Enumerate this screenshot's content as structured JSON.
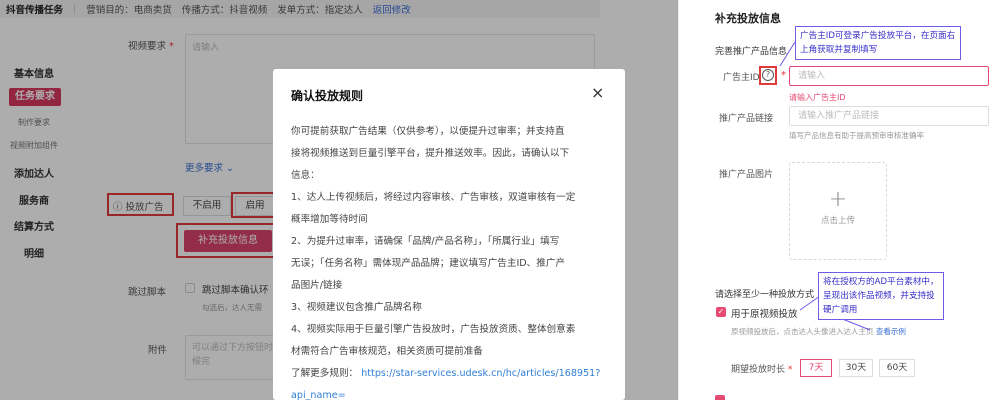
{
  "topbar": {
    "app": "抖音传播任务",
    "goal": "营销目的：电商卖货",
    "method": "传播方式：抖音视频",
    "publish": "发单方式：指定达人",
    "back": "返回修改"
  },
  "sidebar": {
    "basic": "基本信息",
    "task_req": "任务要求",
    "make_req": "制作要求",
    "video_widget": "视频附加组件",
    "add_talent": "添加达人",
    "service": "服务商",
    "settle": "结算方式",
    "detail": "明细"
  },
  "form": {
    "video_req_label": "视频要求",
    "video_req_placeholder": "请输入",
    "more_req": "更多要求",
    "ad_label": "投放广告",
    "opt_off": "不启用",
    "opt_on": "启用",
    "supplement_btn": "补充投放信息",
    "skip_label": "跳过脚本",
    "skip_text": "跳过脚本确认环",
    "skip_hint": "勾选后，达人无需",
    "attach_label": "附件",
    "attach_placeholder": "可以通过下方按钮时候完"
  },
  "modal": {
    "title": "确认投放规则",
    "close": "×",
    "lines": [
      "你可提前获取广告结果（仅供参考），以便提升过审率；并支持直",
      "接将视频推送到巨量引擎平台，提升推送效率。因此，请确认以下",
      "信息：",
      "1、达人上传视频后，将经过内容审核、广告审核，双道审核有一定",
      "概率增加等待时间",
      "2、为提升过审率，请确保「品牌/产品名称」，「所属行业」填写",
      "无误；「任务名称」需体现产品品牌；建议填写广告主ID、推广产",
      "品图片/链接",
      "3、视频建议包含推广品牌名称",
      "4、视频实际用于巨量引擎广告投放时，广告投放资质、整体创意素",
      "材需符合广告审核规范，相关资质可提前准备"
    ],
    "learn_more": "了解更多规则：",
    "link1": "https://star-services.udesk.cn/hc/articles/168951?",
    "link2": "api_name="
  },
  "panel": {
    "title": "补充投放信息",
    "complete_label": "完善推广产品信息",
    "advertiser_label": "广告主ID",
    "help_icon": "?",
    "advertiser_placeholder": "请输入",
    "advertiser_error": "请输入广告主ID",
    "link_label": "推广产品链接",
    "link_placeholder": "请输入推广产品链接",
    "link_hint": "填写产品信息有助于提高预审审核准确率",
    "image_label": "推广产品图片",
    "upload_plus": "+",
    "upload_text": "点击上传",
    "choose_label": "请选择至少一种投放方式",
    "orig_video_label": "用于原视频投放",
    "orig_video_hint": "原视频投放后，点击达人头像进入达人主页",
    "see_example": "查看示例",
    "duration_label": "期望投放时长",
    "durations": [
      "7天",
      "30天",
      "60天"
    ]
  },
  "notes": {
    "note1": "广告主ID可登录广告投放平台，在页面右上角获取并复制填写",
    "note2": "将在授权方的AD平台素材中，呈现出该作品视频，并支持投硬广调用"
  },
  "colors": {
    "accent": "#d9436d",
    "annotation_red": "#e03b3b",
    "annotation_purple": "#6d5ce8"
  }
}
